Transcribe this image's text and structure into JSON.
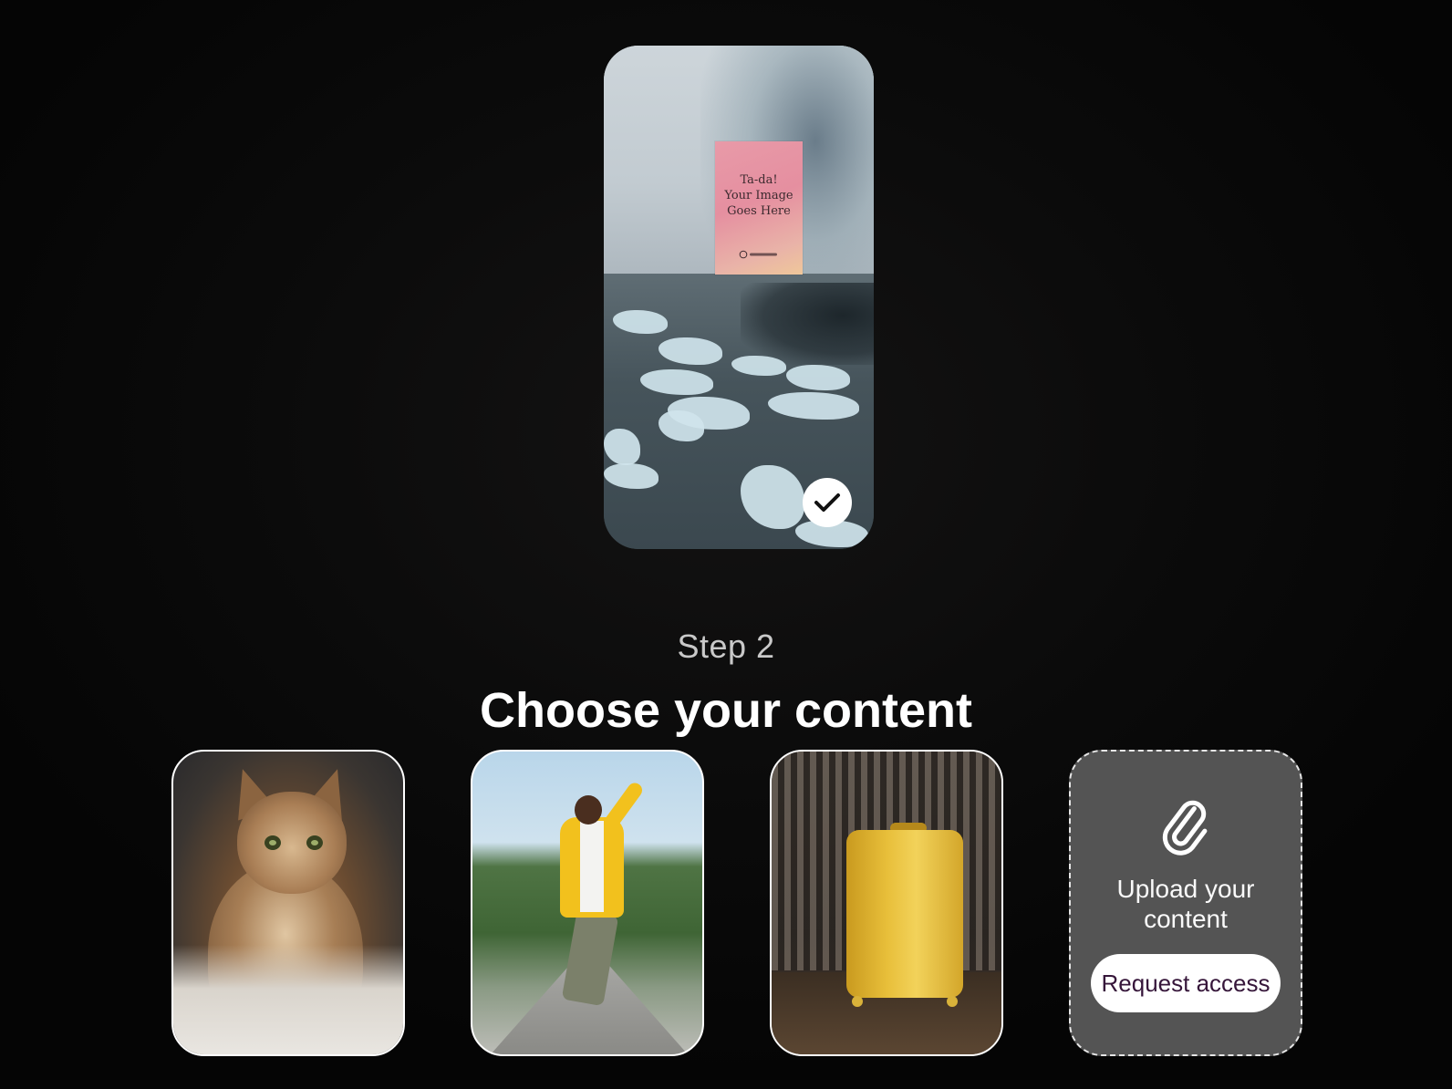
{
  "preview": {
    "poster_text": "Ta-da!\nYour Image\nGoes Here",
    "poster_logo": "OpenAI logo",
    "selected": true
  },
  "step": {
    "label": "Step 2",
    "title": "Choose your content"
  },
  "content_options": [
    {
      "name": "cat",
      "kind": "image"
    },
    {
      "name": "jumping-man",
      "kind": "image"
    },
    {
      "name": "yellow-suitcase",
      "kind": "image"
    },
    {
      "name": "upload",
      "kind": "upload",
      "label": "Upload your content",
      "button": "Request access",
      "icon": "paperclip-icon"
    }
  ],
  "colors": {
    "background": "#0b0b0b",
    "card_border": "#ffffff",
    "upload_card": "#545454",
    "button_text": "#36163a"
  }
}
